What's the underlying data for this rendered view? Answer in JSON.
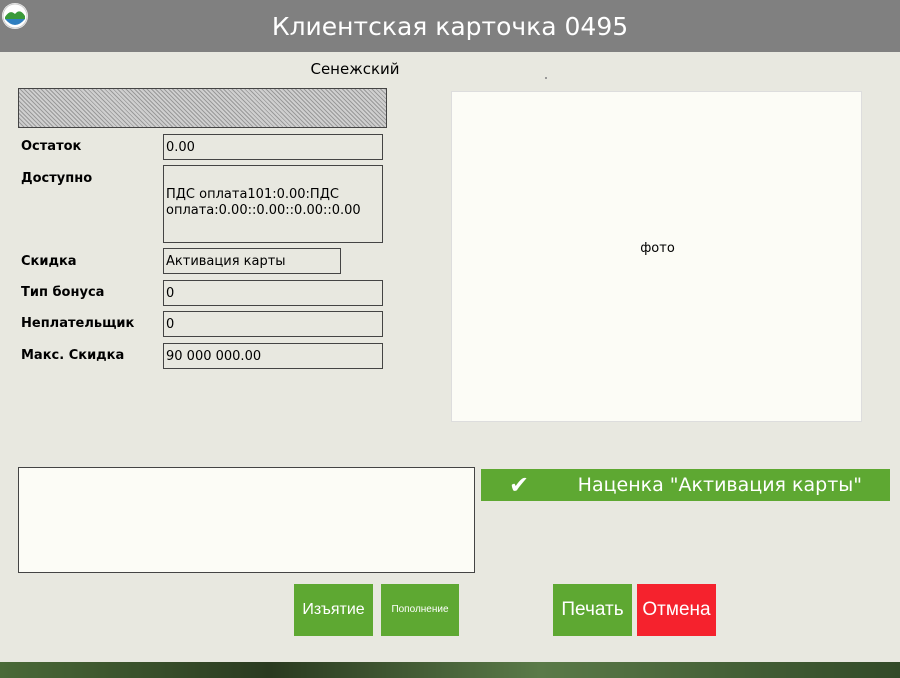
{
  "window": {
    "title": "Клиентская карточка 0495",
    "subtitle": "Сенежский"
  },
  "fields": [
    {
      "label": "Остаток",
      "value": "0.00"
    },
    {
      "label": "Доступно",
      "value": "ПДС оплата101:0.00:ПДС\nоплата:0.00::0.00::0.00::0.00"
    },
    {
      "label": "Скидка",
      "value": "Активация карты"
    },
    {
      "label": "Тип бонуса",
      "value": "0"
    },
    {
      "label": "Неплательщик",
      "value": "0"
    },
    {
      "label": "Макс. Скидка",
      "value": "90 000 000.00"
    }
  ],
  "photo": {
    "label": "фото"
  },
  "markup_banner": {
    "icon": "check-icon",
    "text": "Наценка \"Активация карты\""
  },
  "buttons": {
    "withdraw": "Изъятие",
    "topup": "Пополнение",
    "print": "Печать",
    "cancel": "Отмена"
  },
  "colors": {
    "titlebar": "#808080",
    "background": "#e8e8e0",
    "green": "#5ea832",
    "red": "#f5222d"
  }
}
